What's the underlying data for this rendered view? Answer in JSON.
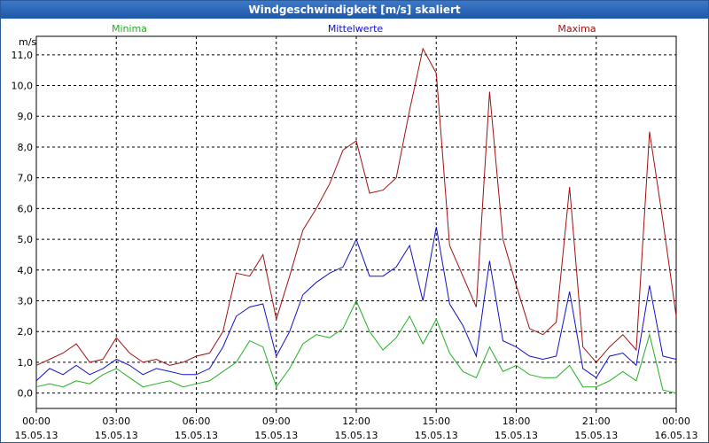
{
  "window": {
    "title": "Windgeschwindigkeit [m/s] skaliert"
  },
  "colors": {
    "minima": "#22b022",
    "mittelwerte": "#1010c8",
    "maxima": "#a01010",
    "title_bar": "#2a66b8",
    "grid": "#000000"
  },
  "chart_data": {
    "type": "line",
    "title": "Windgeschwindigkeit [m/s] skaliert",
    "ylabel": "m/s",
    "xlabel": "",
    "ylim": [
      -0.5,
      11.6
    ],
    "y_ticks": [
      "0,0",
      "1,0",
      "2,0",
      "3,0",
      "4,0",
      "5,0",
      "6,0",
      "7,0",
      "8,0",
      "9,0",
      "10,0",
      "11,0"
    ],
    "x_ticks": [
      {
        "time": "00:00",
        "date": "15.05.13"
      },
      {
        "time": "03:00",
        "date": "15.05.13"
      },
      {
        "time": "06:00",
        "date": "15.05.13"
      },
      {
        "time": "09:00",
        "date": "15.05.13"
      },
      {
        "time": "12:00",
        "date": "15.05.13"
      },
      {
        "time": "15:00",
        "date": "15.05.13"
      },
      {
        "time": "18:00",
        "date": "15.05.13"
      },
      {
        "time": "21:00",
        "date": "15.05.13"
      },
      {
        "time": "00:00",
        "date": "16.05.13"
      }
    ],
    "x_range_hours": [
      0,
      24
    ],
    "grid": true,
    "legend_placement": "top",
    "series": [
      {
        "name": "Minima",
        "color": "#22b022",
        "x": [
          0,
          0.5,
          1,
          1.5,
          2,
          2.5,
          3,
          3.5,
          4,
          4.5,
          5,
          5.5,
          6,
          6.5,
          7,
          7.5,
          8,
          8.5,
          9,
          9.5,
          10,
          10.5,
          11,
          11.5,
          12,
          12.5,
          13,
          13.5,
          14,
          14.5,
          15,
          15.5,
          16,
          16.5,
          17,
          17.5,
          18,
          18.5,
          19,
          19.5,
          20,
          20.5,
          21,
          21.5,
          22,
          22.5,
          23,
          23.5,
          24
        ],
        "values": [
          0.2,
          0.3,
          0.2,
          0.4,
          0.3,
          0.6,
          0.8,
          0.5,
          0.2,
          0.3,
          0.4,
          0.2,
          0.3,
          0.4,
          0.7,
          1.0,
          1.7,
          1.5,
          0.2,
          0.8,
          1.6,
          1.9,
          1.8,
          2.1,
          3.0,
          2.0,
          1.4,
          1.8,
          2.5,
          1.6,
          2.4,
          1.3,
          0.7,
          0.5,
          1.5,
          0.7,
          0.9,
          0.6,
          0.5,
          0.5,
          0.9,
          0.2,
          0.2,
          0.4,
          0.7,
          0.4,
          1.9,
          0.1,
          0.0
        ]
      },
      {
        "name": "Mittelwerte",
        "color": "#1010c8",
        "x": [
          0,
          0.5,
          1,
          1.5,
          2,
          2.5,
          3,
          3.5,
          4,
          4.5,
          5,
          5.5,
          6,
          6.5,
          7,
          7.5,
          8,
          8.5,
          9,
          9.5,
          10,
          10.5,
          11,
          11.5,
          12,
          12.5,
          13,
          13.5,
          14,
          14.5,
          15,
          15.5,
          16,
          16.5,
          17,
          17.5,
          18,
          18.5,
          19,
          19.5,
          20,
          20.5,
          21,
          21.5,
          22,
          22.5,
          23,
          23.5,
          24
        ],
        "values": [
          0.4,
          0.8,
          0.6,
          0.9,
          0.6,
          0.8,
          1.1,
          0.9,
          0.6,
          0.8,
          0.7,
          0.6,
          0.6,
          0.8,
          1.5,
          2.5,
          2.8,
          2.9,
          1.2,
          2.0,
          3.2,
          3.6,
          3.9,
          4.1,
          5.0,
          3.8,
          3.8,
          4.1,
          4.8,
          3.0,
          5.4,
          2.9,
          2.2,
          1.2,
          4.3,
          1.7,
          1.5,
          1.2,
          1.1,
          1.2,
          3.3,
          0.8,
          0.5,
          1.2,
          1.3,
          0.9,
          3.5,
          1.2,
          1.1
        ]
      },
      {
        "name": "Maxima",
        "color": "#a01010",
        "x": [
          0,
          0.5,
          1,
          1.5,
          2,
          2.5,
          3,
          3.5,
          4,
          4.5,
          5,
          5.5,
          6,
          6.5,
          7,
          7.5,
          8,
          8.5,
          9,
          9.5,
          10,
          10.5,
          11,
          11.5,
          12,
          12.5,
          13,
          13.5,
          14,
          14.5,
          15,
          15.5,
          16,
          16.5,
          17,
          17.5,
          18,
          18.5,
          19,
          19.5,
          20,
          20.5,
          21,
          21.5,
          22,
          22.5,
          23,
          23.5,
          24
        ],
        "values": [
          0.9,
          1.1,
          1.3,
          1.6,
          1.0,
          1.1,
          1.8,
          1.3,
          1.0,
          1.1,
          0.9,
          1.0,
          1.2,
          1.3,
          2.0,
          3.9,
          3.8,
          4.5,
          2.4,
          3.8,
          5.3,
          6.0,
          6.8,
          7.9,
          8.2,
          6.5,
          6.6,
          7.0,
          9.2,
          11.2,
          10.4,
          4.8,
          3.8,
          2.8,
          9.8,
          5.0,
          3.5,
          2.1,
          1.9,
          2.3,
          6.7,
          1.5,
          1.0,
          1.5,
          1.9,
          1.4,
          8.5,
          5.6,
          2.5
        ]
      }
    ]
  }
}
